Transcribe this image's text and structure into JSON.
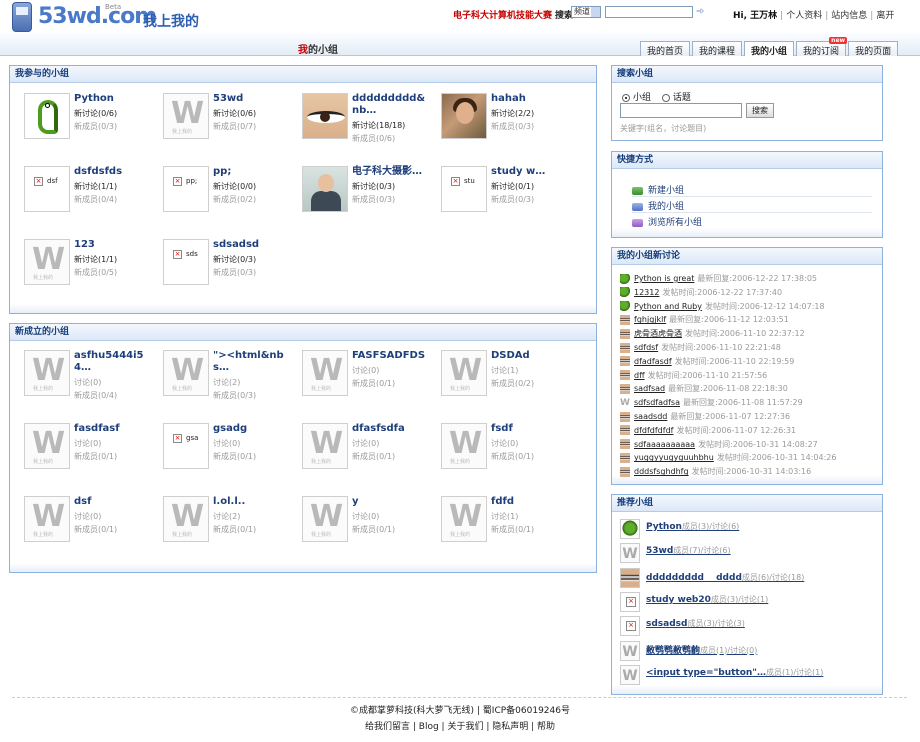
{
  "header": {
    "brand": "53wd.com",
    "beta": "Beta",
    "slogan": "我上我的",
    "contest_link": "电子科大计算机技能大赛",
    "search_label": "搜索",
    "search_select": "频道",
    "greeting": "Hi, 王万林",
    "user_links": [
      "个人资料",
      "站内信息",
      "离开"
    ]
  },
  "nav": {
    "title_prefix": "我",
    "title_rest": "的小组",
    "tabs": [
      {
        "label": "我的首页",
        "active": false
      },
      {
        "label": "我的课程",
        "active": false
      },
      {
        "label": "我的小组",
        "active": true
      },
      {
        "label": "我的订阅",
        "active": false,
        "badge": "new"
      },
      {
        "label": "我的页面",
        "active": false
      }
    ]
  },
  "my_groups": {
    "title": "我参与的小组",
    "items": [
      {
        "name": "Python",
        "line1": "新讨论(0/6)",
        "line2": "新成员(0/3)",
        "thumb": "snake"
      },
      {
        "name": "53wd",
        "line1": "新讨论(0/6)",
        "line2": "新成员(0/7)",
        "thumb": "w"
      },
      {
        "name": "ddddddddd&nb…",
        "line1": "新讨论(18/18)",
        "line2": "新成员(0/6)",
        "thumb": "eye"
      },
      {
        "name": "hahah",
        "line1": "新讨论(2/2)",
        "line2": "新成员(0/3)",
        "thumb": "photo"
      },
      {
        "name": "dsfdsfds",
        "line1": "新讨论(1/1)",
        "line2": "新成员(0/4)",
        "thumb": "broken",
        "alt": "dsf"
      },
      {
        "name": "pp;",
        "line1": "新讨论(0/0)",
        "line2": "新成员(0/2)",
        "thumb": "broken",
        "alt": "pp;"
      },
      {
        "name": "电子科大摄影…",
        "line1": "新讨论(0/3)",
        "line2": "新成员(0/3)",
        "thumb": "man"
      },
      {
        "name": "study w…",
        "line1": "新讨论(0/1)",
        "line2": "新成员(0/3)",
        "thumb": "broken",
        "alt": "stu"
      },
      {
        "name": "123",
        "line1": "新讨论(1/1)",
        "line2": "新成员(0/5)",
        "thumb": "w"
      },
      {
        "name": "sdsadsd",
        "line1": "新讨论(0/3)",
        "line2": "新成员(0/3)",
        "thumb": "broken",
        "alt": "sds"
      }
    ]
  },
  "new_groups": {
    "title": "新成立的小组",
    "items": [
      {
        "name": "asfhu5444i54…",
        "line1": "讨论(0)",
        "line2": "新成员(0/4)",
        "thumb": "w"
      },
      {
        "name": "\"><html&nbs…",
        "line1": "讨论(2)",
        "line2": "新成员(0/3)",
        "thumb": "w"
      },
      {
        "name": "FASFSADFDS",
        "line1": "讨论(0)",
        "line2": "新成员(0/1)",
        "thumb": "w"
      },
      {
        "name": "DSDAd",
        "line1": "讨论(1)",
        "line2": "新成员(0/2)",
        "thumb": "w"
      },
      {
        "name": "fasdfasf",
        "line1": "讨论(0)",
        "line2": "新成员(0/1)",
        "thumb": "w"
      },
      {
        "name": "gsadg",
        "line1": "讨论(0)",
        "line2": "新成员(0/1)",
        "thumb": "broken",
        "alt": "gsa"
      },
      {
        "name": "dfasfsdfa",
        "line1": "讨论(0)",
        "line2": "新成员(0/1)",
        "thumb": "w"
      },
      {
        "name": "fsdf",
        "line1": "讨论(0)",
        "line2": "新成员(0/1)",
        "thumb": "w"
      },
      {
        "name": "dsf",
        "line1": "讨论(0)",
        "line2": "新成员(0/1)",
        "thumb": "w"
      },
      {
        "name": "l.ol.l..",
        "line1": "讨论(2)",
        "line2": "新成员(0/1)",
        "thumb": "w"
      },
      {
        "name": "y",
        "line1": "讨论(0)",
        "line2": "新成员(0/1)",
        "thumb": "w"
      },
      {
        "name": "fdfd",
        "line1": "讨论(1)",
        "line2": "新成员(0/1)",
        "thumb": "w"
      }
    ]
  },
  "search_panel": {
    "title": "搜索小组",
    "opt_group": "小组",
    "opt_topic": "话题",
    "button": "搜索",
    "hint": "关键字(组名，讨论题目)"
  },
  "quick_panel": {
    "title": "快捷方式",
    "links": [
      "新建小组",
      "我的小组",
      "浏览所有小组"
    ]
  },
  "topics_panel": {
    "title": "我的小组新讨论",
    "items": [
      {
        "title": "Python is great",
        "meta": "最新回复:2006-12-22 17:38:05",
        "icon": "snake"
      },
      {
        "title": "12312",
        "meta": "发帖时间:2006-12-22 17:37:40",
        "icon": "snake"
      },
      {
        "title": "Python and Ruby",
        "meta": "发帖时间:2006-12-12 14:07:18",
        "icon": "snake"
      },
      {
        "title": "fghjgjklf",
        "meta": "最新回复:2006-11-12 12:03:51",
        "icon": "eye"
      },
      {
        "title": "虎骨酒虎骨酒",
        "meta": "发帖时间:2006-11-10 22:37:12",
        "icon": "eye"
      },
      {
        "title": "sdfdsf",
        "meta": "发帖时间:2006-11-10 22:21:48",
        "icon": "eye"
      },
      {
        "title": "dfadfasdf",
        "meta": "发帖时间:2006-11-10 22:19:59",
        "icon": "eye"
      },
      {
        "title": "dff",
        "meta": "发帖时间:2006-11-10 21:57:56",
        "icon": "eye"
      },
      {
        "title": "sadfsad",
        "meta": "最新回复:2006-11-08 22:18:30",
        "icon": "eye"
      },
      {
        "title": "sdfsdfadfsa",
        "meta": "最新回复:2006-11-08 11:57:29",
        "icon": "w"
      },
      {
        "title": "saadsdd",
        "meta": "最新回复:2006-11-07 12:27:36",
        "icon": "eye"
      },
      {
        "title": "dfdfdfdfdf",
        "meta": "发帖时间:2006-11-07 12:26:31",
        "icon": "eye"
      },
      {
        "title": "sdfaaaaaaaaaa",
        "meta": "发帖时间:2006-10-31 14:08:27",
        "icon": "eye"
      },
      {
        "title": "yuggyyugyguuhbhu",
        "meta": "发帖时间:2006-10-31 14:04:26",
        "icon": "eye"
      },
      {
        "title": "dddsfsghdhfg",
        "meta": "发帖时间:2006-10-31 14:03:16",
        "icon": "eye"
      }
    ]
  },
  "recommend_panel": {
    "title": "推荐小组",
    "items": [
      {
        "name": "Python",
        "meta": "成员(3)/讨论(6)",
        "thumb": "snake"
      },
      {
        "name": "53wd",
        "meta": "成员(7)/讨论(6)",
        "thumb": "w"
      },
      {
        "name": "ddddddddd　 dddd",
        "meta": "成员(6)/讨论(18)",
        "thumb": "eye"
      },
      {
        "name": "study web20",
        "meta": "成员(3)/讨论(1)",
        "thumb": "broken"
      },
      {
        "name": "sdsadsd",
        "meta": "成员(3)/讨论(3)",
        "thumb": "broken"
      },
      {
        "name": "敝鹗鹗敝鹗齣",
        "meta": "成员(1)/讨论(0)",
        "thumb": "w"
      },
      {
        "name": "<input type=\"button\"…",
        "meta": "成员(1)/讨论(1)",
        "thumb": "w"
      }
    ]
  },
  "footer": {
    "copyright": "©成都掌萝科技(科大萝飞无线)",
    "icp": "蜀ICP备06019246号",
    "links": [
      "给我们留言",
      "Blog",
      "关于我们",
      "隐私声明",
      "帮助"
    ]
  },
  "colors": {
    "panel_border": "#8eb2e0",
    "panel_header": "#143d7a",
    "accent_red": "#c60000",
    "link_blue": "#1f3f7a"
  }
}
